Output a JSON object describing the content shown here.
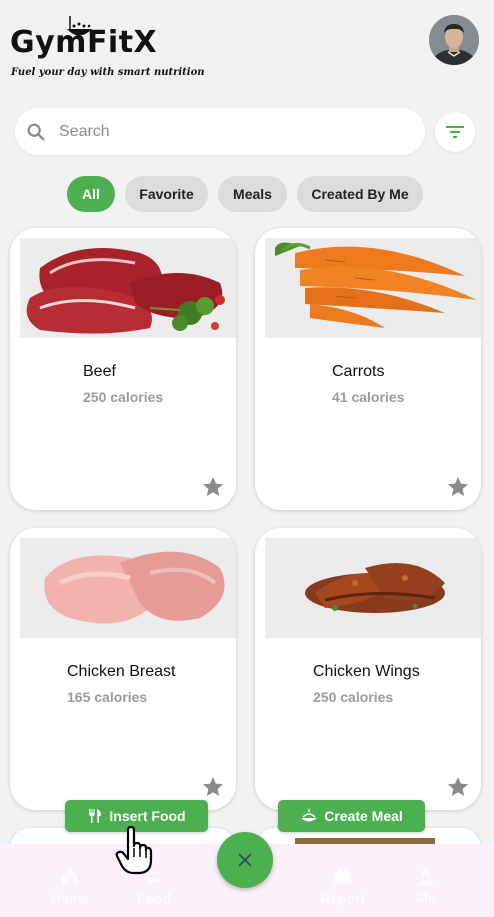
{
  "app": {
    "title": "GymFitX",
    "tagline": "Fuel your day with smart nutrition"
  },
  "search": {
    "placeholder": "Search",
    "value": ""
  },
  "filters": [
    {
      "label": "All",
      "active": true
    },
    {
      "label": "Favorite",
      "active": false
    },
    {
      "label": "Meals",
      "active": false
    },
    {
      "label": "Created By Me",
      "active": false
    }
  ],
  "foods": [
    {
      "name": "Beef",
      "calories": "250 calories",
      "image": "beef-image",
      "favorite": false
    },
    {
      "name": "Carrots",
      "calories": "41 calories",
      "image": "carrots-image",
      "favorite": false
    },
    {
      "name": "Chicken Breast",
      "calories": "165 calories",
      "image": "chicken-breast-image",
      "favorite": false
    },
    {
      "name": "Chicken Wings",
      "calories": "250 calories",
      "image": "chicken-wings-image",
      "favorite": false
    }
  ],
  "actions": {
    "insert_food": "Insert Food",
    "create_meal": "Create Meal",
    "fab_icon": "close-icon"
  },
  "nav": [
    {
      "label": "Home",
      "icon": "home-icon"
    },
    {
      "label": "Food",
      "icon": "food-icon"
    },
    {
      "label": "Report",
      "icon": "report-icon"
    },
    {
      "label": "Me",
      "icon": "person-icon"
    }
  ],
  "colors": {
    "accent": "#4caf50",
    "chip_inactive": "#dcdcdc",
    "background": "#f2f2f2",
    "star": "#8a8a8a",
    "nav_background": "#fbf1fb"
  }
}
